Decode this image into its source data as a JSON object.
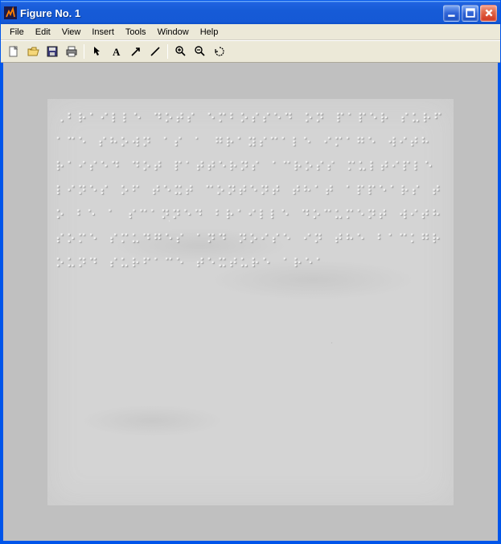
{
  "window": {
    "title": "Figure No. 1"
  },
  "menubar": {
    "items": [
      "File",
      "Edit",
      "View",
      "Insert",
      "Tools",
      "Window",
      "Help"
    ]
  },
  "toolbar": {
    "buttons": [
      {
        "name": "new-figure-button",
        "icon": "new-icon",
        "tooltip": "New Figure"
      },
      {
        "name": "open-button",
        "icon": "open-icon",
        "tooltip": "Open"
      },
      {
        "name": "save-button",
        "icon": "save-icon",
        "tooltip": "Save"
      },
      {
        "name": "print-button",
        "icon": "print-icon",
        "tooltip": "Print"
      },
      {
        "sep": true
      },
      {
        "name": "edit-plot-button",
        "icon": "arrow-icon",
        "tooltip": "Edit Plot"
      },
      {
        "name": "insert-text-button",
        "icon": "text-icon",
        "tooltip": "Insert Text"
      },
      {
        "name": "insert-arrow-button",
        "icon": "arrow-ne-icon",
        "tooltip": "Insert Arrow"
      },
      {
        "name": "insert-line-button",
        "icon": "line-icon",
        "tooltip": "Insert Line"
      },
      {
        "sep": true
      },
      {
        "name": "zoom-in-button",
        "icon": "zoom-in-icon",
        "tooltip": "Zoom In"
      },
      {
        "name": "zoom-out-button",
        "icon": "zoom-out-icon",
        "tooltip": "Zoom Out"
      },
      {
        "name": "rotate-3d-button",
        "icon": "rotate-icon",
        "tooltip": "Rotate 3D"
      }
    ]
  },
  "figure": {
    "content_type": "braille-embossed-image",
    "description": "Grayscale embossed braille dot pattern on light gray paper background with faint smudges",
    "braille_text": "⠠⠃⠗⠁⠊⠇⠇⠑ ⠙⠕⠞⠎ ⠑⠍⠃⠕⠎⠎⠑⠙ ⠕⠝ ⠏⠁⠏⠑⠗ ⠎⠥⠗⠋⠁⠉⠑ ⠎⠓⠕⠺⠝ ⠁⠎ ⠁ ⠛⠗⠁⠽⠎⠉⠁⠇⠑ ⠊⠍⠁⠛⠑ ⠺⠊⠞⠓ ⠗⠁⠊⠎⠑⠙ ⠙⠕⠞ ⠏⠁⠞⠞⠑⠗⠝⠎ ⠁⠉⠗⠕⠎⠎ ⠍⠥⠇⠞⠊⠏⠇⠑ ⠇⠊⠝⠑⠎ ⠕⠋ ⠞⠑⠭⠞ ⠉⠕⠝⠞⠑⠝⠞ ⠞⠓⠁⠞ ⠁⠏⠏⠑⠁⠗⠎ ⠞⠕ ⠃⠑ ⠁ ⠎⠉⠁⠝⠝⠑⠙ ⠃⠗⠁⠊⠇⠇⠑ ⠙⠕⠉⠥⠍⠑⠝⠞ ⠺⠊⠞⠓ ⠎⠕⠍⠑ ⠎⠍⠥⠙⠛⠑⠎ ⠁⠝⠙ ⠝⠕⠊⠎⠑ ⠊⠝ ⠞⠓⠑ ⠃⠁⠉⠅⠛⠗⠕⠥⠝⠙ ⠎⠥⠗⠋⠁⠉⠑ ⠞⠑⠭⠞⠥⠗⠑ ⠁⠗⠑⠁"
  },
  "colors": {
    "xp_blue": "#0055ea",
    "xp_titlebar_gradient_top": "#3f8cf3",
    "xp_titlebar_gradient_bottom": "#0d4fc9",
    "xp_beige": "#ece9d8",
    "figure_bg": "#c0c0c0",
    "canvas_bg": "#d4d4d4"
  }
}
